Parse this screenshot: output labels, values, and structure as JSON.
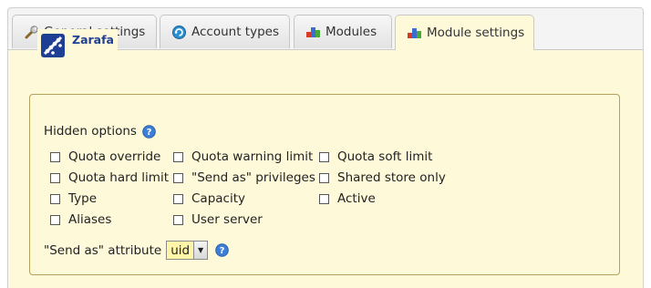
{
  "tabs": [
    {
      "label": "General settings",
      "icon": "wrench-icon",
      "active": false
    },
    {
      "label": "Account types",
      "icon": "refresh-icon",
      "active": false
    },
    {
      "label": "Modules",
      "icon": "modules-icon",
      "active": false
    },
    {
      "label": "Module settings",
      "icon": "modules-icon",
      "active": true
    }
  ],
  "section": {
    "title": "Zarafa",
    "logo": "zarafa-logo",
    "hidden_options_label": "Hidden options",
    "checkboxes": [
      {
        "label": "Quota override",
        "checked": false
      },
      {
        "label": "Quota hard limit",
        "checked": false
      },
      {
        "label": "Type",
        "checked": false
      },
      {
        "label": "Aliases",
        "checked": false
      },
      {
        "label": "Quota warning limit",
        "checked": false
      },
      {
        "label": "\"Send as\" privileges",
        "checked": false
      },
      {
        "label": "Capacity",
        "checked": false
      },
      {
        "label": "User server",
        "checked": false
      },
      {
        "label": "Quota soft limit",
        "checked": false
      },
      {
        "label": "Shared store only",
        "checked": false
      },
      {
        "label": "Active",
        "checked": false
      }
    ],
    "send_as_label": "\"Send as\" attribute",
    "send_as_value": "uid"
  },
  "colors": {
    "panel_bg": "#fdf9d9",
    "title": "#1f3f95",
    "select_bg": "#fff6a8",
    "fieldset_border": "#b4a25a"
  }
}
